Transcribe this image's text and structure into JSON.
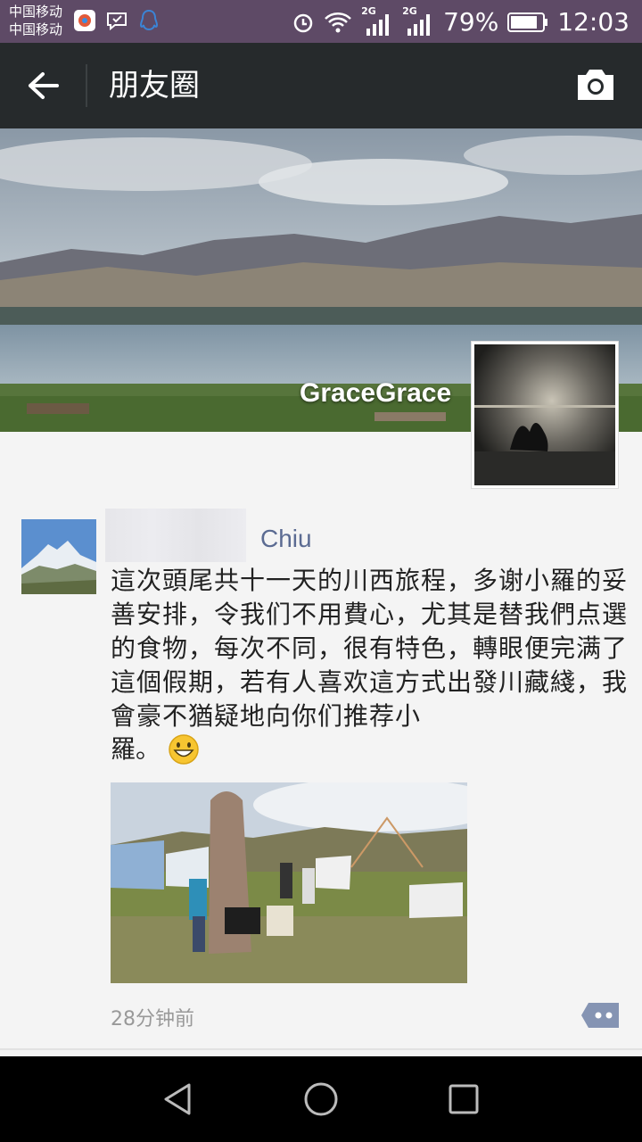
{
  "status_bar": {
    "carrier_1": "中国移动",
    "carrier_2": "中国移动",
    "battery": "79%",
    "time": "12:03",
    "network_1": "2G",
    "network_2": "2G"
  },
  "app_bar": {
    "title": "朋友圈",
    "back_icon": "arrow-left-icon",
    "camera_icon": "camera-icon"
  },
  "profile": {
    "username": "GraceGrace"
  },
  "post": {
    "author": "Chiu",
    "text": "這次頭尾共十一天的川西旅程，多谢小羅的妥善安排，令我们不用費心，尤其是替我們点選的食物，每次不同，很有特色，轉眼便完满了這個假期，若有人喜欢這方式出發川藏綫，我會豪不猶疑地向你们推荐小",
    "text_end": "羅。",
    "time": "28分钟前"
  },
  "colors": {
    "status_bar": "#5e4a66",
    "app_bar": "#262a2c",
    "author_name": "#5b6b92",
    "background": "#f4f4f4"
  }
}
